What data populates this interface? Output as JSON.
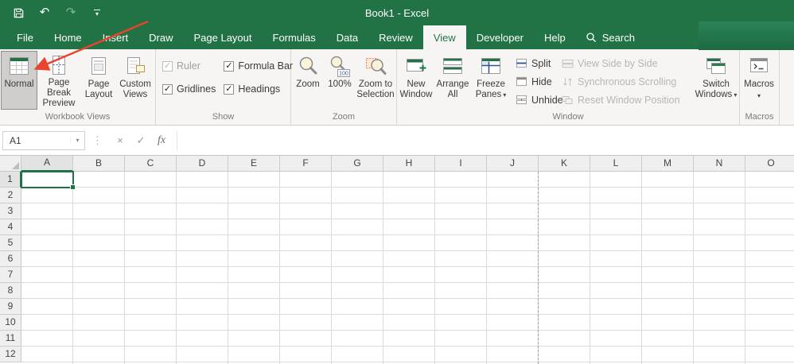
{
  "colors": {
    "accent": "#217346",
    "tab_active_text": "#217346"
  },
  "icons": {
    "caret": "▾",
    "dots": "⋮",
    "cancel": "×",
    "check": "✓",
    "undo": "↶",
    "redo": "↷"
  },
  "titlebar": {
    "title": "Book1 - Excel"
  },
  "tabs": {
    "items": [
      {
        "label": "File",
        "active": false
      },
      {
        "label": "Home",
        "active": false
      },
      {
        "label": "Insert",
        "active": false
      },
      {
        "label": "Draw",
        "active": false
      },
      {
        "label": "Page Layout",
        "active": false
      },
      {
        "label": "Formulas",
        "active": false
      },
      {
        "label": "Data",
        "active": false
      },
      {
        "label": "Review",
        "active": false
      },
      {
        "label": "View",
        "active": true
      },
      {
        "label": "Developer",
        "active": false
      },
      {
        "label": "Help",
        "active": false
      }
    ]
  },
  "search": {
    "label": "Search"
  },
  "ribbon": {
    "workbook_views": {
      "group_label": "Workbook Views",
      "buttons": [
        {
          "label": "Normal",
          "selected": true
        },
        {
          "label": "Page Break Preview",
          "selected": false
        },
        {
          "label": "Page Layout",
          "selected": false
        },
        {
          "label": "Custom Views",
          "selected": false
        }
      ]
    },
    "show": {
      "group_label": "Show",
      "checkboxes": [
        {
          "label": "Ruler",
          "checked": true,
          "disabled": true
        },
        {
          "label": "Gridlines",
          "checked": true,
          "disabled": false
        },
        {
          "label": "Formula Bar",
          "checked": true,
          "disabled": false
        },
        {
          "label": "Headings",
          "checked": true,
          "disabled": false
        }
      ]
    },
    "zoom": {
      "group_label": "Zoom",
      "buttons": [
        {
          "label": "Zoom"
        },
        {
          "label": "100%"
        },
        {
          "label": "Zoom to Selection"
        }
      ]
    },
    "window": {
      "group_label": "Window",
      "big_buttons": [
        {
          "label": "New Window",
          "dropdown": false
        },
        {
          "label": "Arrange All",
          "dropdown": false
        },
        {
          "label": "Freeze Panes",
          "dropdown": true
        }
      ],
      "small_buttons": [
        {
          "label": "Split"
        },
        {
          "label": "Hide"
        },
        {
          "label": "Unhide"
        }
      ],
      "disabled_buttons": [
        {
          "label": "View Side by Side"
        },
        {
          "label": "Synchronous Scrolling"
        },
        {
          "label": "Reset Window Position"
        }
      ],
      "switch_windows": {
        "label": "Switch Windows",
        "dropdown": true
      }
    },
    "macros": {
      "group_label": "Macros",
      "button": {
        "label": "Macros",
        "dropdown": true
      }
    }
  },
  "formula_bar": {
    "name_box_value": "A1",
    "fx_label": "fx"
  },
  "grid": {
    "column_headers": [
      "A",
      "B",
      "C",
      "D",
      "E",
      "F",
      "G",
      "H",
      "I",
      "J",
      "K",
      "L",
      "M",
      "N",
      "O"
    ],
    "row_count": 12,
    "selected_cell": "A1",
    "page_break_after_column": "J"
  },
  "annotation": {
    "arrow_color": "#e8442e"
  }
}
